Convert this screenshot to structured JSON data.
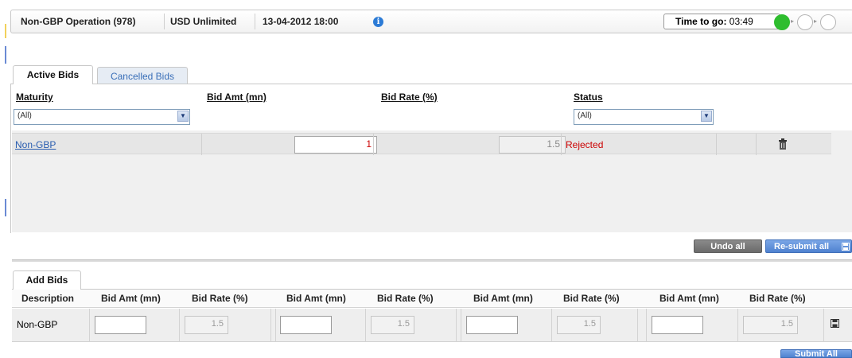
{
  "header": {
    "operation": "Non-GBP Operation (978)",
    "currency": "USD Unlimited",
    "datetime": "13-04-2012 18:00",
    "info_icon": "info-icon",
    "time_label": "Time to go:",
    "time_value": "03:49",
    "status_colors": {
      "active": "#2ebd2e",
      "inactive": "#ffffff"
    }
  },
  "tabs": [
    {
      "label": "Active Bids",
      "active": true
    },
    {
      "label": "Cancelled Bids",
      "active": false
    }
  ],
  "active_bids": {
    "columns": [
      "Maturity",
      "Bid Amt (mn)",
      "Bid Rate (%)",
      "Status"
    ],
    "filters": {
      "maturity": "(All)",
      "status": "(All)"
    },
    "rows": [
      {
        "maturity": "Non-GBP",
        "bid_amt": "1",
        "bid_rate": "1.5",
        "status": "Rejected",
        "delete_icon": "trash-icon"
      }
    ]
  },
  "actions": {
    "undo_all": "Undo all",
    "resubmit_all": "Re-submit all",
    "resubmit_icon": "save-icon"
  },
  "add_bids": {
    "tab_label": "Add Bids",
    "columns": [
      "Description",
      "Bid Amt (mn)",
      "Bid Rate (%)",
      "Bid Amt (mn)",
      "Bid Rate (%)",
      "Bid Amt (mn)",
      "Bid Rate (%)",
      "Bid Amt (mn)",
      "Bid Rate (%)"
    ],
    "row": {
      "description": "Non-GBP",
      "bid_amts": [
        "",
        "",
        "",
        ""
      ],
      "bid_rates": [
        "1.5",
        "1.5",
        "1.5",
        "1.5"
      ],
      "save_icon": "save-icon"
    },
    "submit_all": "Submit All"
  },
  "colors": {
    "link": "#2a5db0",
    "rejected": "#cc0000",
    "button_blue": "#4f82d0",
    "button_dark": "#6b6b6b"
  }
}
